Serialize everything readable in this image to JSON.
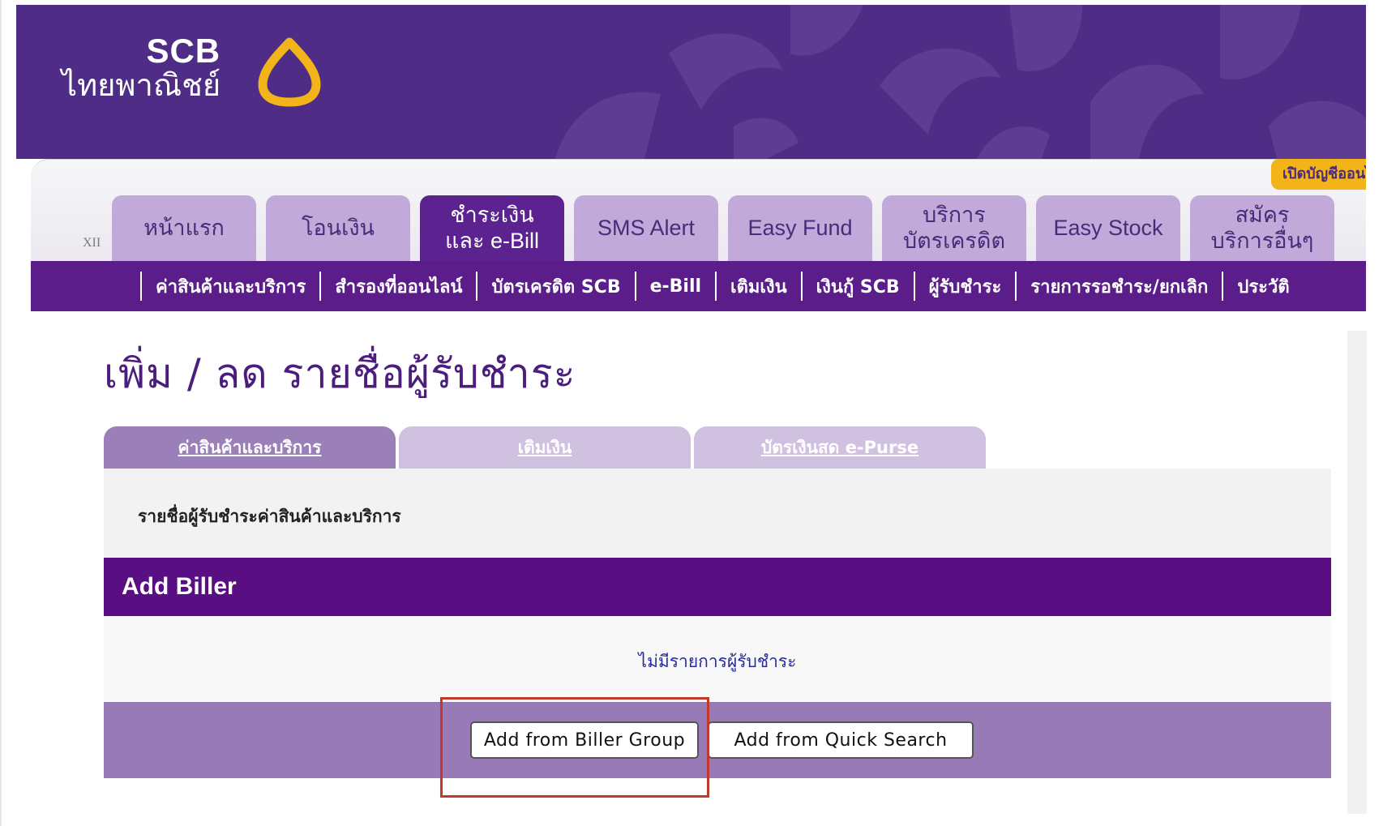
{
  "brand": {
    "name_en": "SCB",
    "name_th": "ไทยพาณิชย์",
    "accent_color": "#f2b418",
    "primary_color": "#5a0e83"
  },
  "header": {
    "promo_badge": "เปิดบัญชีออนไลน์",
    "xii_label": "XII"
  },
  "main_tabs": [
    {
      "lines": [
        "หน้าแรก"
      ],
      "active": false
    },
    {
      "lines": [
        "โอนเงิน"
      ],
      "active": false
    },
    {
      "lines": [
        "ชำระเงิน",
        "และ e-Bill"
      ],
      "active": true
    },
    {
      "lines": [
        "SMS Alert"
      ],
      "active": false
    },
    {
      "lines": [
        "Easy Fund"
      ],
      "active": false
    },
    {
      "lines": [
        "บริการ",
        "บัตรเครดิต"
      ],
      "active": false
    },
    {
      "lines": [
        "Easy Stock"
      ],
      "active": false
    },
    {
      "lines": [
        "สมัคร",
        "บริการอื่นๆ"
      ],
      "active": false
    }
  ],
  "sub_nav": [
    "ค่าสินค้าและบริการ",
    "สำรองที่ออนไลน์",
    "บัตรเครดิต SCB",
    "e-Bill",
    "เติมเงิน",
    "เงินกู้ SCB",
    "ผู้รับชำระ",
    "รายการรอชำระ/ยกเลิก",
    "ประวัติ"
  ],
  "page": {
    "title": "เพิ่ม / ลด รายชื่อผู้รับชำระ"
  },
  "content_tabs": [
    {
      "label": "ค่าสินค้าและบริการ",
      "active": true
    },
    {
      "label": "เติมเงิน",
      "active": false
    },
    {
      "label": "บัตรเงินสด e-Purse",
      "active": false
    }
  ],
  "biller_list": {
    "label": "รายชื่อผู้รับชำระค่าสินค้าและบริการ",
    "section_title": "Add Biller",
    "empty_message": "ไม่มีรายการผู้รับชำระ"
  },
  "actions": {
    "add_from_group": "Add from Biller Group",
    "add_from_search": "Add from Quick Search"
  }
}
